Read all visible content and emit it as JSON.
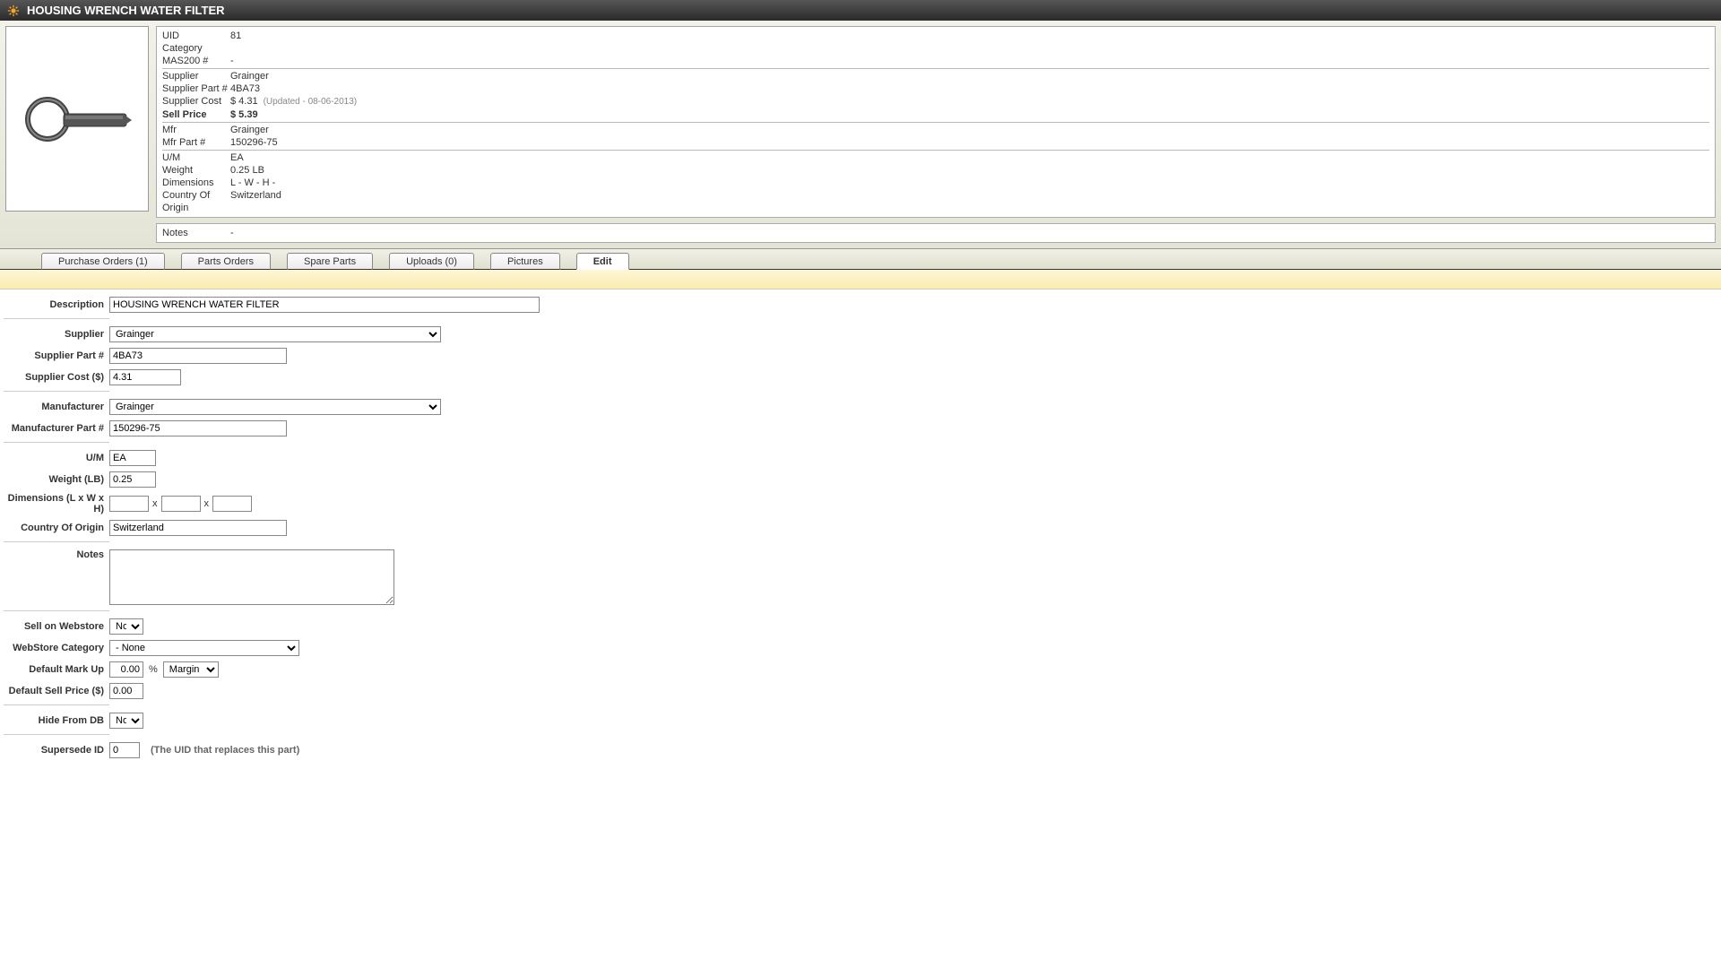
{
  "header": {
    "title": "HOUSING WRENCH WATER FILTER"
  },
  "info": {
    "uid_label": "UID",
    "uid": "81",
    "category_label": "Category",
    "category": "",
    "mas200_label": "MAS200 #",
    "mas200": "-",
    "supplier_label": "Supplier",
    "supplier": "Grainger",
    "supplier_part_label": "Supplier Part #",
    "supplier_part": "4BA73",
    "supplier_cost_label": "Supplier Cost",
    "supplier_cost": "$ 4.31",
    "supplier_cost_updated": "(Updated - 08-06-2013)",
    "sell_price_label": "Sell Price",
    "sell_price": "$ 5.39",
    "mfr_label": "Mfr",
    "mfr": "Grainger",
    "mfr_part_label": "Mfr Part #",
    "mfr_part": "150296-75",
    "um_label": "U/M",
    "um": "EA",
    "weight_label": "Weight",
    "weight": "0.25 LB",
    "dimensions_label": "Dimensions",
    "dimensions": "L -   W -   H -",
    "coo_label": "Country Of Origin",
    "coo": "Switzerland",
    "notes_label": "Notes",
    "notes": "-"
  },
  "tabs": [
    {
      "label": "Purchase Orders (1)",
      "active": false
    },
    {
      "label": "Parts Orders",
      "active": false
    },
    {
      "label": "Spare Parts",
      "active": false
    },
    {
      "label": "Uploads (0)",
      "active": false
    },
    {
      "label": "Pictures",
      "active": false
    },
    {
      "label": "Edit",
      "active": true
    }
  ],
  "form": {
    "description_label": "Description",
    "description": "HOUSING WRENCH WATER FILTER",
    "supplier_label": "Supplier",
    "supplier": "Grainger",
    "supplier_part_label": "Supplier Part #",
    "supplier_part": "4BA73",
    "supplier_cost_label": "Supplier Cost ($)",
    "supplier_cost": "4.31",
    "manufacturer_label": "Manufacturer",
    "manufacturer": "Grainger",
    "manufacturer_part_label": "Manufacturer Part #",
    "manufacturer_part": "150296-75",
    "um_label": "U/M",
    "um": "EA",
    "weight_label": "Weight (LB)",
    "weight": "0.25",
    "dimensions_label": "Dimensions (L x W x H)",
    "dim_l": "",
    "dim_w": "",
    "dim_h": "",
    "dim_x": "x",
    "coo_label": "Country Of Origin",
    "coo": "Switzerland",
    "notes_label": "Notes",
    "notes": "",
    "sell_webstore_label": "Sell on Webstore",
    "sell_webstore": "No",
    "ws_category_label": "WebStore Category",
    "ws_category": "- None",
    "default_markup_label": "Default Mark Up",
    "default_markup": "0.00",
    "pct": "%",
    "markup_type": "Margin",
    "default_sell_label": "Default Sell Price ($)",
    "default_sell": "0.00",
    "hide_db_label": "Hide From DB",
    "hide_db": "No",
    "supersede_label": "Supersede ID",
    "supersede": "0",
    "supersede_hint": "(The UID that replaces this part)"
  }
}
